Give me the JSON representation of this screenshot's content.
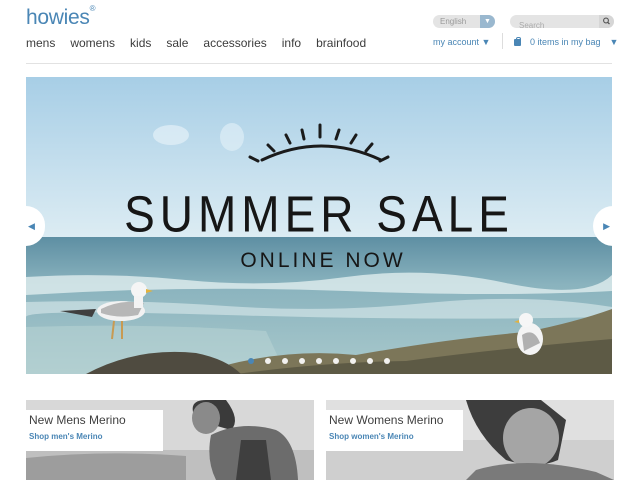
{
  "brand": {
    "name": "howies",
    "mark": "®"
  },
  "nav": [
    "mens",
    "womens",
    "kids",
    "sale",
    "accessories",
    "info",
    "brainfood"
  ],
  "language": {
    "selected": "English"
  },
  "search": {
    "placeholder": "Search"
  },
  "account": {
    "label": "my account"
  },
  "bag": {
    "label": "0 items in my bag"
  },
  "hero": {
    "headline": "SUMMER SALE",
    "subline": "ONLINE NOW",
    "slide_count": 9,
    "active_slide": 1
  },
  "promos": [
    {
      "title": "New Mens Merino",
      "link": "Shop men's Merino"
    },
    {
      "title": "New Womens Merino",
      "link": "Shop women's Merino"
    }
  ],
  "colors": {
    "accent": "#4a86b5",
    "sky": "#b9d8ea",
    "sea": "#8fb4bf"
  }
}
